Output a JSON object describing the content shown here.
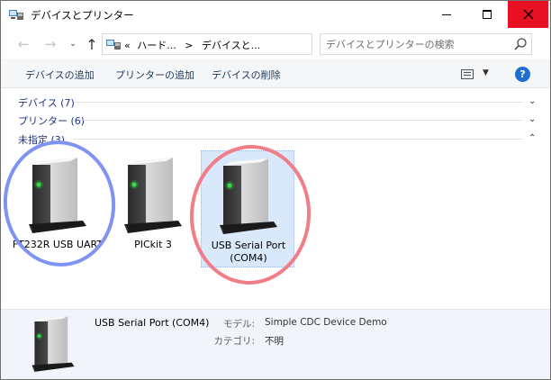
{
  "window": {
    "title": "デバイスとプリンター"
  },
  "nav": {
    "back": "←",
    "forward": "→",
    "recent": "⌄",
    "up": "↑"
  },
  "address": {
    "prefix": "«",
    "segment1": "ハード...",
    "separator": ">",
    "segment2": "デバイスと..."
  },
  "search": {
    "placeholder": "デバイスとプリンターの検索"
  },
  "commands": {
    "add_device": "デバイスの追加",
    "add_printer": "プリンターの追加",
    "remove_device": "デバイスの削除",
    "help": "?"
  },
  "groups": [
    {
      "label": "デバイス (7)",
      "expanded": false
    },
    {
      "label": "プリンター (6)",
      "expanded": false
    },
    {
      "label": "未指定 (3)",
      "expanded": true
    }
  ],
  "devices": [
    {
      "name": "FT232R USB UART",
      "selected": false
    },
    {
      "name": "PICkit 3",
      "selected": false
    },
    {
      "name": "USB Serial Port (COM4)",
      "selected": true
    }
  ],
  "details": {
    "name": "USB Serial Port (COM4)",
    "model_label": "モデル:",
    "model_value": "Simple CDC Device Demo",
    "category_label": "カテゴリ:",
    "category_value": "不明"
  },
  "colors": {
    "close_button": "#e81123",
    "link_text": "#1e3287",
    "selection": "#d9e9fb",
    "annotation_blue": "#7f93f2",
    "annotation_red": "#f07d87",
    "status_led": "#33dd44"
  }
}
